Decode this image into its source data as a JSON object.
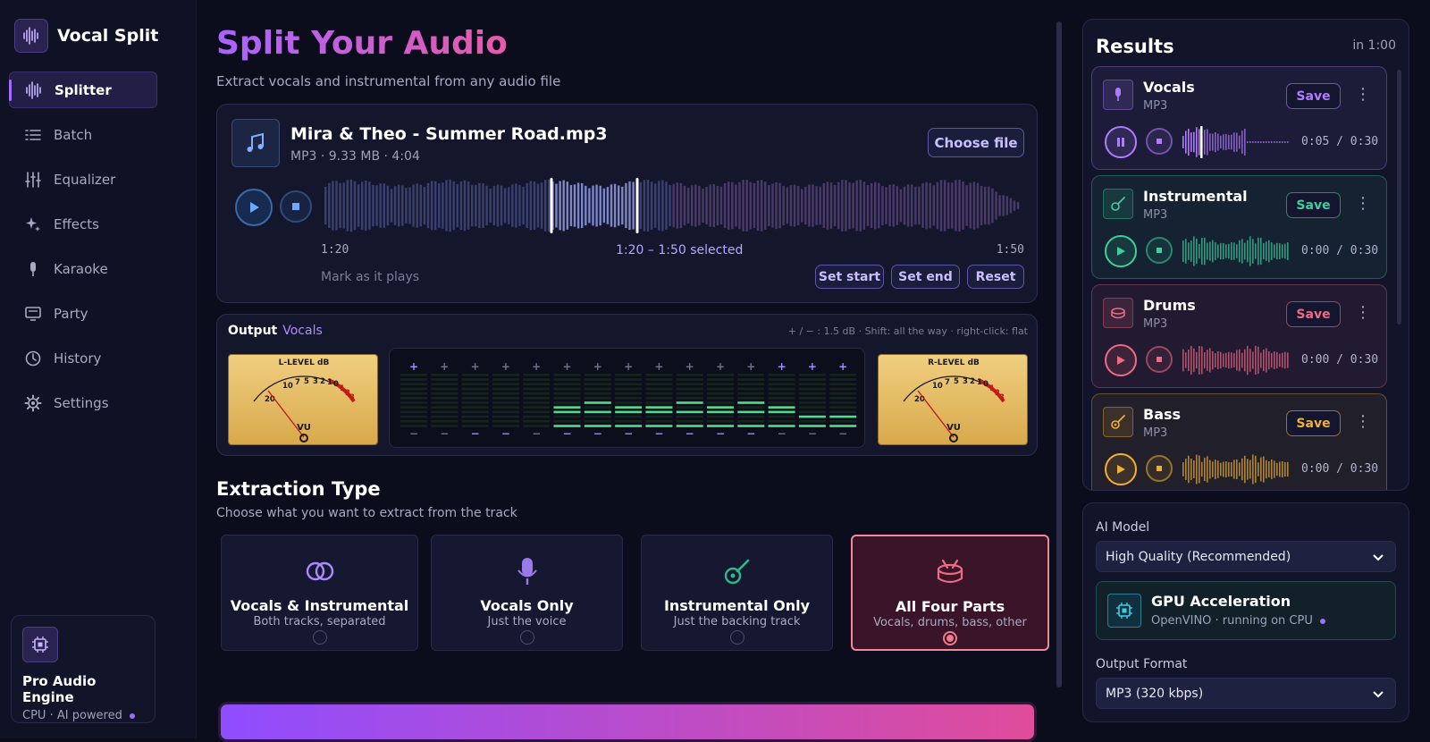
{
  "app": {
    "name": "Vocal Split"
  },
  "nav": [
    {
      "label": "Splitter",
      "icon": "waveform-icon",
      "active": true
    },
    {
      "label": "Batch",
      "icon": "list-icon"
    },
    {
      "label": "Equalizer",
      "icon": "sliders-icon"
    },
    {
      "label": "Effects",
      "icon": "sparkle-icon"
    },
    {
      "label": "Karaoke",
      "icon": "microphone-icon"
    },
    {
      "label": "Party",
      "icon": "monitor-icon"
    },
    {
      "label": "History",
      "icon": "clock-icon"
    },
    {
      "label": "Settings",
      "icon": "gear-icon"
    }
  ],
  "engine": {
    "title": "Pro Audio Engine",
    "subtitle": "CPU · AI powered"
  },
  "header": {
    "title": "Split Your Audio",
    "subtitle": "Extract vocals and instrumental from any audio file"
  },
  "file": {
    "name": "Mira & Theo - Summer Road.mp3",
    "meta": "MP3 · 9.33 MB · 4:04",
    "choose_label": "Choose file",
    "time_start": "1:20",
    "selection": "1:20 – 1:50 selected",
    "time_end": "1:50",
    "mark_label": "Mark as it plays",
    "set_start": "Set start",
    "set_end": "Set end",
    "reset": "Reset"
  },
  "eq": {
    "output_label": "Output",
    "output_value": "Vocals",
    "hint": "+ / − : 1.5 dB · Shift: all the way · right-click: flat",
    "left_meter": {
      "title": "L-LEVEL dB",
      "unit": "VU",
      "scale": [
        "20",
        "10",
        "7",
        "5",
        "3",
        "2",
        "1",
        "0",
        "1",
        "2",
        "3"
      ]
    },
    "right_meter": {
      "title": "R-LEVEL dB",
      "unit": "VU",
      "scale": [
        "20",
        "10",
        "7",
        "5",
        "3",
        "2",
        "1",
        "0",
        "1",
        "2",
        "3"
      ]
    },
    "bands": [
      0,
      0,
      0,
      0,
      0,
      2,
      3,
      2,
      2,
      3,
      2,
      3,
      2,
      1,
      1
    ]
  },
  "extraction": {
    "title": "Extraction Type",
    "subtitle": "Choose what you want to extract from the track",
    "options": [
      {
        "title": "Vocals & Instrumental",
        "desc": "Both tracks, separated",
        "icon": "rings-icon",
        "selected": false
      },
      {
        "title": "Vocals Only",
        "desc": "Just the voice",
        "icon": "microphone-icon",
        "selected": false
      },
      {
        "title": "Instrumental Only",
        "desc": "Just the backing track",
        "icon": "guitar-icon",
        "selected": false
      },
      {
        "title": "All Four Parts",
        "desc": "Vocals, drums, bass, other",
        "icon": "drum-icon",
        "selected": true
      }
    ]
  },
  "results": {
    "title": "Results",
    "time": "in 1:00",
    "save_label": "Save",
    "stems": [
      {
        "name": "Vocals",
        "format": "MP3",
        "time": "0:05 / 0:30",
        "progress": 0.17,
        "playing": true,
        "color": "#b07cff",
        "icon": "microphone-icon"
      },
      {
        "name": "Instrumental",
        "format": "MP3",
        "time": "0:00 / 0:30",
        "progress": 0,
        "playing": false,
        "color": "#3ccf9f",
        "icon": "guitar-icon"
      },
      {
        "name": "Drums",
        "format": "MP3",
        "time": "0:00 / 0:30",
        "progress": 0,
        "playing": false,
        "color": "#f06a84",
        "icon": "drum-icon"
      },
      {
        "name": "Bass",
        "format": "MP3",
        "time": "0:00 / 0:30",
        "progress": 0,
        "playing": false,
        "color": "#f0b030",
        "icon": "bass-guitar-icon"
      }
    ]
  },
  "settings": {
    "model_label": "AI Model",
    "model_value": "High Quality (Recommended)",
    "gpu_title": "GPU Acceleration",
    "gpu_sub": "OpenVINO · running on CPU",
    "format_label": "Output Format",
    "format_value": "MP3 (320 kbps)"
  },
  "start": {
    "label": ""
  }
}
